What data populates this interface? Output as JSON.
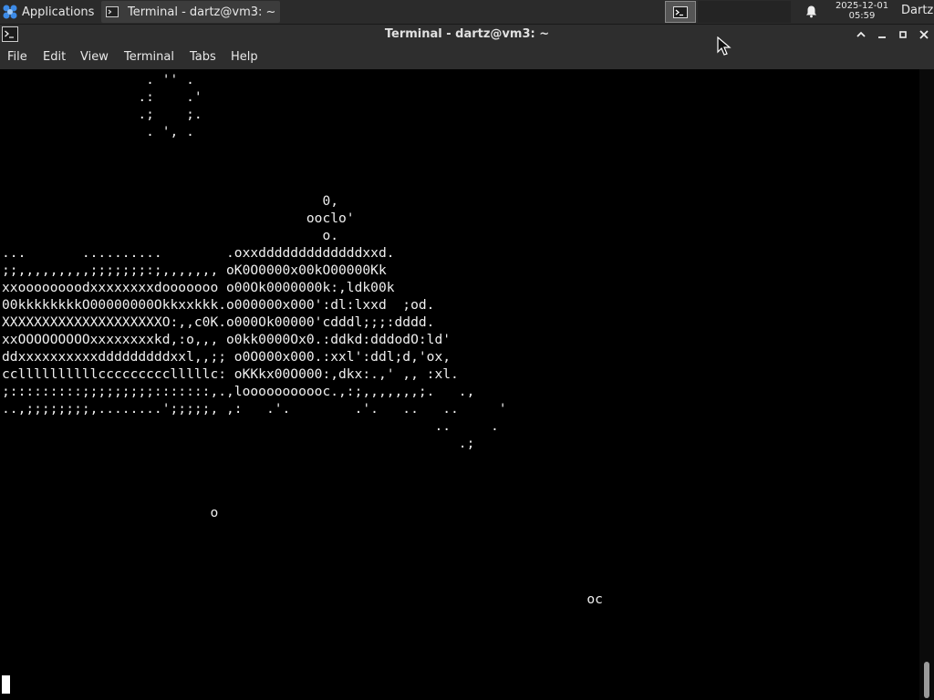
{
  "panel": {
    "applications_label": "Applications",
    "task_label": "Terminal - dartz@vm3: ~",
    "clock_date": "2025-12-01",
    "clock_time": "05:59",
    "user": "Dartz",
    "icons": [
      "xfce-logo-icon",
      "terminal-icon",
      "bell-icon"
    ]
  },
  "window": {
    "title": "Terminal - dartz@vm3: ~",
    "controls": [
      "chevron-up-icon",
      "minimize-icon",
      "maximize-icon",
      "close-icon"
    ]
  },
  "menubar": {
    "items": [
      "File",
      "Edit",
      "View",
      "Terminal",
      "Tabs",
      "Help"
    ]
  },
  "terminal": {
    "lines": [
      "                  . '' .",
      "                 .:    .'",
      "                 .;    ;.",
      "                  . ', .",
      "",
      "",
      "",
      "                                        0,",
      "                                      ooclo'",
      "                                        o.",
      "...       ..........        .oxxdddddddddddddxxd.",
      ";;,,,,,,,,,;;;;;;;:;,,,,,,, oK0O0000x00kO00000Kk",
      "xxoooooooodxxxxxxxxdooooooo o00Ok0000000k:,ldk00k",
      "00kkkkkkkkO00000000Okkxxkkk.o000000x000':dl:lxxd  ;od.",
      "XXXXXXXXXXXXXXXXXXXXO:,,c0K.o000Ok00000'cdddl;;;:dddd.",
      "xxOOOOOOOOOxxxxxxxxkd,:o,,, o0kk0000Ox0.:ddkd:dddodO:ld'",
      "ddxxxxxxxxxxdddddddddxxl,,;; o0O000x000.:xxl':ddl;d,'ox,",
      "ccllllllllllccccccccclllllc: oKKkx00O000:,dkx:.,' ,, :xl.",
      ";:::::::::;;;;;;;;;:::::::,.,looooooooooc.,:;,,,,,,,;.   .,",
      "..,;;;;;;;;,........';;;;;, ,:   .'.        .'.   ..   ..     '",
      "                                                      ..     .",
      "                                                         .;",
      "",
      "",
      "",
      "                          o",
      "",
      "",
      "",
      "",
      "                                                                         oc"
    ]
  }
}
